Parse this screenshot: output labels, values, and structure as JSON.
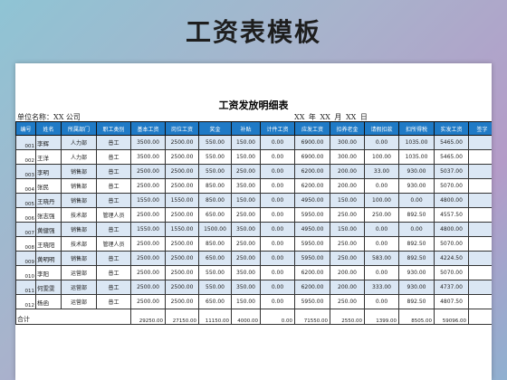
{
  "banner": {
    "title": "工资表模板"
  },
  "sheet": {
    "title": "工资发放明细表",
    "unit_label": "单位名称：XX 公司",
    "date_label": "XX 年 XX 月 XX 日"
  },
  "table": {
    "headers": [
      "编号",
      "姓名",
      "所属部门",
      "职工类别",
      "基本工资",
      "岗位工资",
      "奖金",
      "补贴",
      "计件工资",
      "应发工资",
      "扣养老金",
      "请假扣款",
      "扣所得税",
      "实发工资",
      "签字"
    ],
    "rows": [
      {
        "id": "001",
        "name": "李辉",
        "dept": "人力部",
        "type": "普工",
        "base": "3500.00",
        "post": "2500.00",
        "bonus": "550.00",
        "allow": "150.00",
        "piece": "0.00",
        "gross": "6900.00",
        "pension": "300.00",
        "leave": "0.00",
        "tax": "1035.00",
        "net": "5465.00",
        "sign": ""
      },
      {
        "id": "002",
        "name": "王洋",
        "dept": "人力部",
        "type": "普工",
        "base": "3500.00",
        "post": "2500.00",
        "bonus": "550.00",
        "allow": "150.00",
        "piece": "0.00",
        "gross": "6900.00",
        "pension": "300.00",
        "leave": "100.00",
        "tax": "1035.00",
        "net": "5465.00",
        "sign": ""
      },
      {
        "id": "003",
        "name": "李明",
        "dept": "销售部",
        "type": "普工",
        "base": "2500.00",
        "post": "2500.00",
        "bonus": "550.00",
        "allow": "250.00",
        "piece": "0.00",
        "gross": "6200.00",
        "pension": "200.00",
        "leave": "33.00",
        "tax": "930.00",
        "net": "5037.00",
        "sign": ""
      },
      {
        "id": "004",
        "name": "张民",
        "dept": "销售部",
        "type": "普工",
        "base": "2500.00",
        "post": "2500.00",
        "bonus": "850.00",
        "allow": "350.00",
        "piece": "0.00",
        "gross": "6200.00",
        "pension": "200.00",
        "leave": "0.00",
        "tax": "930.00",
        "net": "5070.00",
        "sign": ""
      },
      {
        "id": "005",
        "name": "王晓丹",
        "dept": "销售部",
        "type": "普工",
        "base": "1550.00",
        "post": "1550.00",
        "bonus": "850.00",
        "allow": "150.00",
        "piece": "0.00",
        "gross": "4950.00",
        "pension": "150.00",
        "leave": "100.00",
        "tax": "0.00",
        "net": "4800.00",
        "sign": ""
      },
      {
        "id": "006",
        "name": "张志强",
        "dept": "技术部",
        "type": "管理人员",
        "base": "2500.00",
        "post": "2500.00",
        "bonus": "650.00",
        "allow": "250.00",
        "piece": "0.00",
        "gross": "5950.00",
        "pension": "250.00",
        "leave": "250.00",
        "tax": "892.50",
        "net": "4557.50",
        "sign": ""
      },
      {
        "id": "007",
        "name": "黄健强",
        "dept": "销售部",
        "type": "普工",
        "base": "1550.00",
        "post": "1550.00",
        "bonus": "1500.00",
        "allow": "350.00",
        "piece": "0.00",
        "gross": "4950.00",
        "pension": "150.00",
        "leave": "0.00",
        "tax": "0.00",
        "net": "4800.00",
        "sign": ""
      },
      {
        "id": "008",
        "name": "王晓阳",
        "dept": "技术部",
        "type": "管理人员",
        "base": "2500.00",
        "post": "2500.00",
        "bonus": "850.00",
        "allow": "250.00",
        "piece": "0.00",
        "gross": "5950.00",
        "pension": "250.00",
        "leave": "0.00",
        "tax": "892.50",
        "net": "5070.00",
        "sign": ""
      },
      {
        "id": "009",
        "name": "黄明明",
        "dept": "销售部",
        "type": "普工",
        "base": "2500.00",
        "post": "2500.00",
        "bonus": "650.00",
        "allow": "250.00",
        "piece": "0.00",
        "gross": "5950.00",
        "pension": "250.00",
        "leave": "583.00",
        "tax": "892.50",
        "net": "4224.50",
        "sign": ""
      },
      {
        "id": "010",
        "name": "李阳",
        "dept": "运营部",
        "type": "普工",
        "base": "2500.00",
        "post": "2500.00",
        "bonus": "550.00",
        "allow": "350.00",
        "piece": "0.00",
        "gross": "6200.00",
        "pension": "200.00",
        "leave": "0.00",
        "tax": "930.00",
        "net": "5070.00",
        "sign": ""
      },
      {
        "id": "011",
        "name": "何雯雯",
        "dept": "运营部",
        "type": "普工",
        "base": "2500.00",
        "post": "2500.00",
        "bonus": "550.00",
        "allow": "350.00",
        "piece": "0.00",
        "gross": "6200.00",
        "pension": "200.00",
        "leave": "333.00",
        "tax": "930.00",
        "net": "4737.00",
        "sign": ""
      },
      {
        "id": "012",
        "name": "杨函",
        "dept": "运营部",
        "type": "普工",
        "base": "2500.00",
        "post": "2500.00",
        "bonus": "650.00",
        "allow": "150.00",
        "piece": "0.00",
        "gross": "5950.00",
        "pension": "250.00",
        "leave": "0.00",
        "tax": "892.50",
        "net": "4807.50",
        "sign": ""
      }
    ],
    "total": {
      "label": "合计",
      "base": "29250.00",
      "post": "27150.00",
      "bonus": "11150.00",
      "allow": "4000.00",
      "piece": "0.00",
      "gross": "71550.00",
      "pension": "2550.00",
      "leave": "1399.00",
      "tax": "8505.00",
      "net": "59096.00"
    }
  }
}
